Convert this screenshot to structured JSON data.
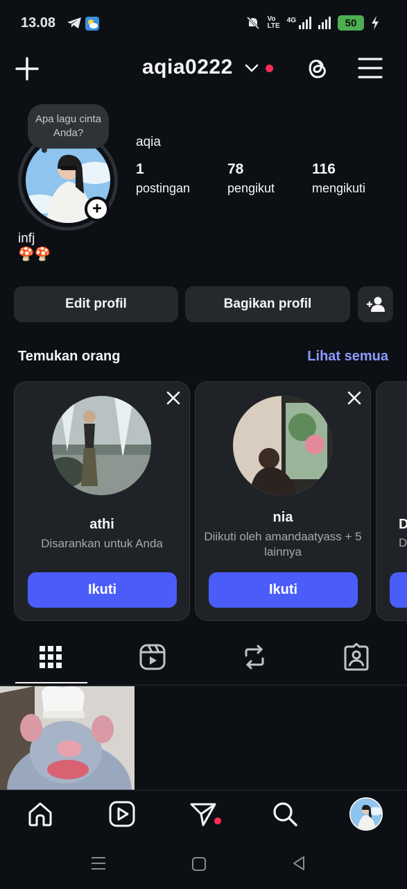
{
  "status": {
    "time": "13.08",
    "battery": "50",
    "network": "4G"
  },
  "header": {
    "username": "aqia0222"
  },
  "profile": {
    "note": "Apa lagu cinta Anda?",
    "display_name": "aqia",
    "bio_line1": "infj",
    "bio_line2": "🍄🍄",
    "stats": [
      {
        "value": "1",
        "label": "postingan"
      },
      {
        "value": "78",
        "label": "pengikut"
      },
      {
        "value": "116",
        "label": "mengikuti"
      }
    ]
  },
  "actions": {
    "edit": "Edit profil",
    "share": "Bagikan profil"
  },
  "discover": {
    "title": "Temukan orang",
    "see_all": "Lihat semua",
    "cards": [
      {
        "name": "athi",
        "subtitle": "Disarankan untuk Anda",
        "button": "Ikuti"
      },
      {
        "name": "nia",
        "subtitle": "Diikuti oleh amandaatyass + 5 lainnya",
        "button": "Ikuti"
      },
      {
        "name": "D",
        "subtitle": "D",
        "button": ""
      }
    ]
  },
  "colors": {
    "accent": "#4a5df9",
    "link": "#8a9bff",
    "notify": "#ff2d55",
    "background": "#0c1014"
  }
}
